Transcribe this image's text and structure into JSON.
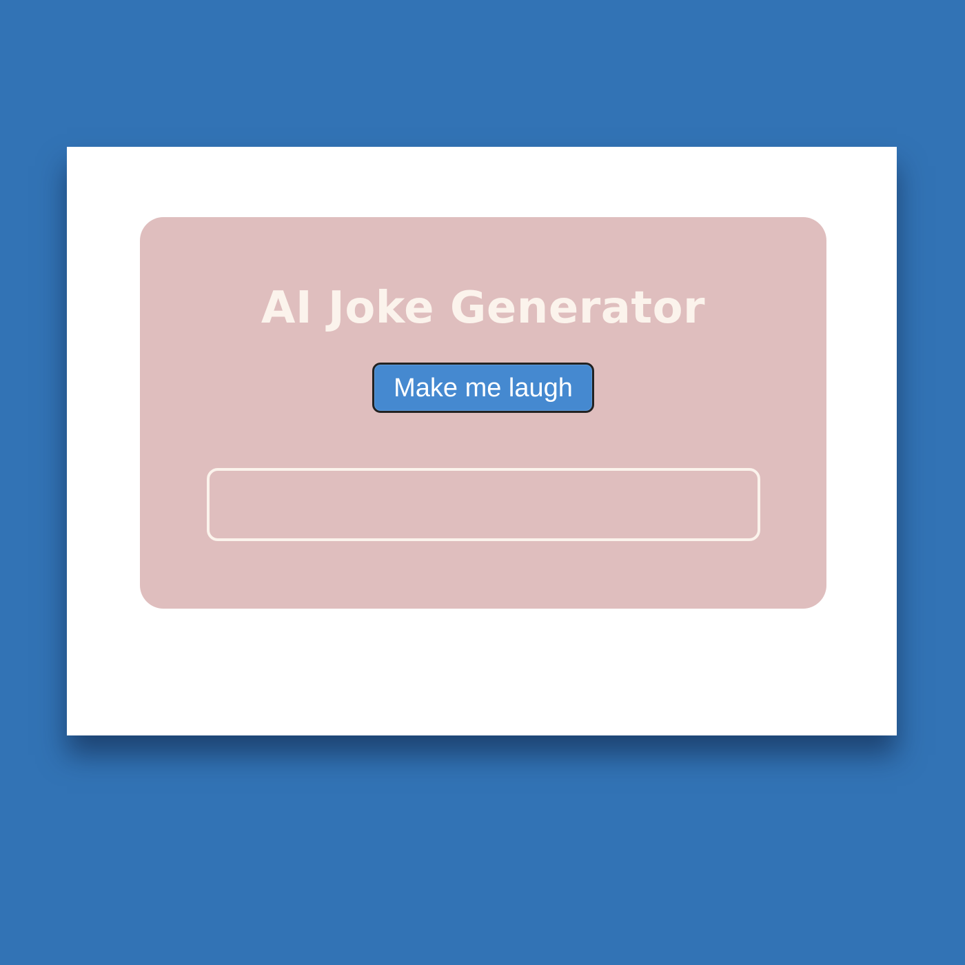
{
  "app": {
    "title": "AI Joke Generator"
  },
  "actions": {
    "generate_label": "Make me laugh"
  },
  "output": {
    "joke_text": ""
  },
  "colors": {
    "page_background": "#3273b5",
    "window_background": "#ffffff",
    "card_background": "#dfbebe",
    "title_color": "#fbf3ec",
    "button_background": "#4589d0",
    "button_text": "#ffffff",
    "output_border": "#fbf3ec"
  }
}
